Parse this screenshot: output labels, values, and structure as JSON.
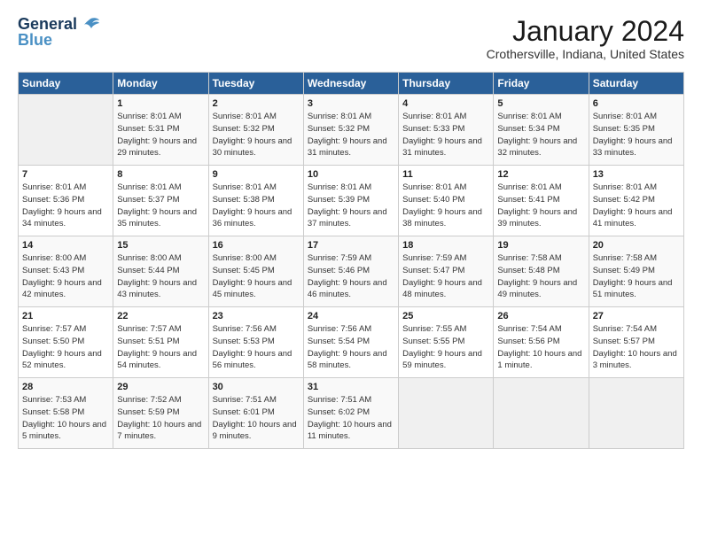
{
  "header": {
    "logo_line1": "General",
    "logo_line2": "Blue",
    "month_year": "January 2024",
    "location": "Crothersville, Indiana, United States"
  },
  "days_of_week": [
    "Sunday",
    "Monday",
    "Tuesday",
    "Wednesday",
    "Thursday",
    "Friday",
    "Saturday"
  ],
  "weeks": [
    [
      {
        "num": "",
        "empty": true
      },
      {
        "num": "1",
        "sunrise": "8:01 AM",
        "sunset": "5:31 PM",
        "daylight": "9 hours and 29 minutes."
      },
      {
        "num": "2",
        "sunrise": "8:01 AM",
        "sunset": "5:32 PM",
        "daylight": "9 hours and 30 minutes."
      },
      {
        "num": "3",
        "sunrise": "8:01 AM",
        "sunset": "5:32 PM",
        "daylight": "9 hours and 31 minutes."
      },
      {
        "num": "4",
        "sunrise": "8:01 AM",
        "sunset": "5:33 PM",
        "daylight": "9 hours and 31 minutes."
      },
      {
        "num": "5",
        "sunrise": "8:01 AM",
        "sunset": "5:34 PM",
        "daylight": "9 hours and 32 minutes."
      },
      {
        "num": "6",
        "sunrise": "8:01 AM",
        "sunset": "5:35 PM",
        "daylight": "9 hours and 33 minutes."
      }
    ],
    [
      {
        "num": "7",
        "sunrise": "8:01 AM",
        "sunset": "5:36 PM",
        "daylight": "9 hours and 34 minutes."
      },
      {
        "num": "8",
        "sunrise": "8:01 AM",
        "sunset": "5:37 PM",
        "daylight": "9 hours and 35 minutes."
      },
      {
        "num": "9",
        "sunrise": "8:01 AM",
        "sunset": "5:38 PM",
        "daylight": "9 hours and 36 minutes."
      },
      {
        "num": "10",
        "sunrise": "8:01 AM",
        "sunset": "5:39 PM",
        "daylight": "9 hours and 37 minutes."
      },
      {
        "num": "11",
        "sunrise": "8:01 AM",
        "sunset": "5:40 PM",
        "daylight": "9 hours and 38 minutes."
      },
      {
        "num": "12",
        "sunrise": "8:01 AM",
        "sunset": "5:41 PM",
        "daylight": "9 hours and 39 minutes."
      },
      {
        "num": "13",
        "sunrise": "8:01 AM",
        "sunset": "5:42 PM",
        "daylight": "9 hours and 41 minutes."
      }
    ],
    [
      {
        "num": "14",
        "sunrise": "8:00 AM",
        "sunset": "5:43 PM",
        "daylight": "9 hours and 42 minutes."
      },
      {
        "num": "15",
        "sunrise": "8:00 AM",
        "sunset": "5:44 PM",
        "daylight": "9 hours and 43 minutes."
      },
      {
        "num": "16",
        "sunrise": "8:00 AM",
        "sunset": "5:45 PM",
        "daylight": "9 hours and 45 minutes."
      },
      {
        "num": "17",
        "sunrise": "7:59 AM",
        "sunset": "5:46 PM",
        "daylight": "9 hours and 46 minutes."
      },
      {
        "num": "18",
        "sunrise": "7:59 AM",
        "sunset": "5:47 PM",
        "daylight": "9 hours and 48 minutes."
      },
      {
        "num": "19",
        "sunrise": "7:58 AM",
        "sunset": "5:48 PM",
        "daylight": "9 hours and 49 minutes."
      },
      {
        "num": "20",
        "sunrise": "7:58 AM",
        "sunset": "5:49 PM",
        "daylight": "9 hours and 51 minutes."
      }
    ],
    [
      {
        "num": "21",
        "sunrise": "7:57 AM",
        "sunset": "5:50 PM",
        "daylight": "9 hours and 52 minutes."
      },
      {
        "num": "22",
        "sunrise": "7:57 AM",
        "sunset": "5:51 PM",
        "daylight": "9 hours and 54 minutes."
      },
      {
        "num": "23",
        "sunrise": "7:56 AM",
        "sunset": "5:53 PM",
        "daylight": "9 hours and 56 minutes."
      },
      {
        "num": "24",
        "sunrise": "7:56 AM",
        "sunset": "5:54 PM",
        "daylight": "9 hours and 58 minutes."
      },
      {
        "num": "25",
        "sunrise": "7:55 AM",
        "sunset": "5:55 PM",
        "daylight": "9 hours and 59 minutes."
      },
      {
        "num": "26",
        "sunrise": "7:54 AM",
        "sunset": "5:56 PM",
        "daylight": "10 hours and 1 minute."
      },
      {
        "num": "27",
        "sunrise": "7:54 AM",
        "sunset": "5:57 PM",
        "daylight": "10 hours and 3 minutes."
      }
    ],
    [
      {
        "num": "28",
        "sunrise": "7:53 AM",
        "sunset": "5:58 PM",
        "daylight": "10 hours and 5 minutes."
      },
      {
        "num": "29",
        "sunrise": "7:52 AM",
        "sunset": "5:59 PM",
        "daylight": "10 hours and 7 minutes."
      },
      {
        "num": "30",
        "sunrise": "7:51 AM",
        "sunset": "6:01 PM",
        "daylight": "10 hours and 9 minutes."
      },
      {
        "num": "31",
        "sunrise": "7:51 AM",
        "sunset": "6:02 PM",
        "daylight": "10 hours and 11 minutes."
      },
      {
        "num": "",
        "empty": true
      },
      {
        "num": "",
        "empty": true
      },
      {
        "num": "",
        "empty": true
      }
    ]
  ]
}
